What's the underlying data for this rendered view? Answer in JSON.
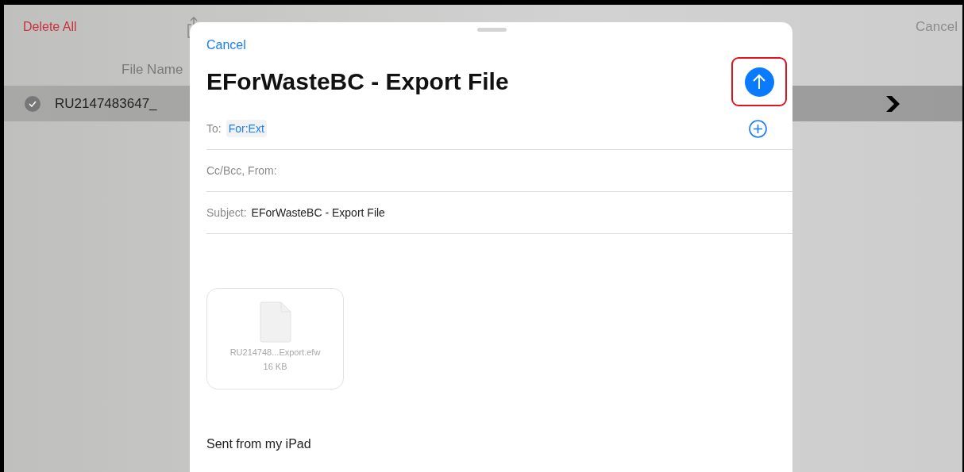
{
  "background": {
    "delete_all": "Delete All",
    "cancel": "Cancel",
    "column_header": "File Name",
    "rows": [
      {
        "name": "RU2147483647_",
        "selected": true
      }
    ]
  },
  "sheet": {
    "cancel": "Cancel",
    "title": "EForWasteBC - Export File",
    "send_highlighted": true,
    "fields": [
      {
        "kind": "recipient",
        "label": "To:",
        "value": "For:Ext"
      },
      {
        "kind": "plain",
        "label": "Cc/Bcc, From:"
      },
      {
        "kind": "plain",
        "label": "Subject:",
        "value": "EForWasteBC - Export File"
      }
    ],
    "attachment": {
      "name": "RU214748...Export.efw",
      "size": "16 KB"
    },
    "signature": "Sent from my iPad"
  }
}
